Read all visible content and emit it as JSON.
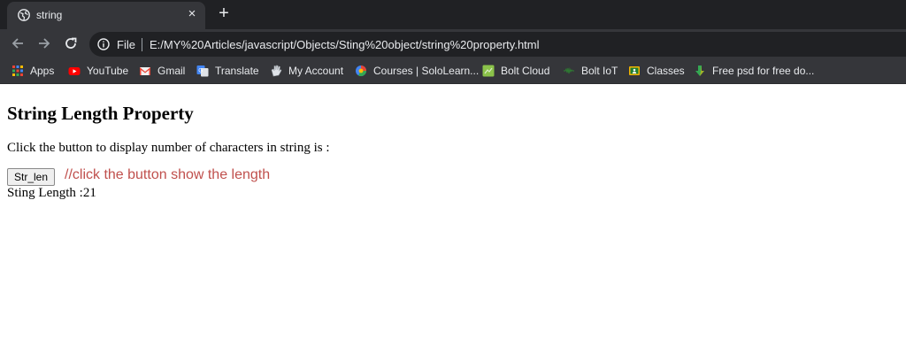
{
  "tab": {
    "title": "string",
    "close": "×"
  },
  "new_tab": "+",
  "address_bar": {
    "scheme_label": "File",
    "url": "E:/MY%20Articles/javascript/Objects/Sting%20object/string%20property.html"
  },
  "bookmarks": [
    {
      "label": "Apps",
      "icon": "apps-grid-icon",
      "color": "#e8453c"
    },
    {
      "label": "YouTube",
      "icon": "youtube-icon",
      "color": "#ff0000"
    },
    {
      "label": "Gmail",
      "icon": "gmail-icon",
      "color": "#ea4335"
    },
    {
      "label": "Translate",
      "icon": "translate-icon",
      "color": "#4285f4"
    },
    {
      "label": "My Account",
      "icon": "my-account-icon",
      "color": "#9aa0a6"
    },
    {
      "label": "Courses | SoloLearn...",
      "icon": "sololearn-icon",
      "color": "#4285f4"
    },
    {
      "label": "Bolt Cloud",
      "icon": "bolt-cloud-icon",
      "color": "#8bc34a"
    },
    {
      "label": "Bolt IoT",
      "icon": "bolt-iot-icon",
      "color": "#2e7d32"
    },
    {
      "label": "Classes",
      "icon": "classes-icon",
      "color": "#f4b400"
    },
    {
      "label": "Free psd for free do...",
      "icon": "download-arrow-icon",
      "color": "#34a853"
    }
  ],
  "page": {
    "heading": "String Length Property",
    "description": "Click the button to display number of characters in string is :",
    "button_label": "Str_len",
    "annotation": "//click the button show the length",
    "result": "Sting Length :21"
  },
  "colors": {
    "annotation": "#c0504d",
    "chrome_dark": "#202124",
    "chrome_toolbar": "#35363a"
  }
}
